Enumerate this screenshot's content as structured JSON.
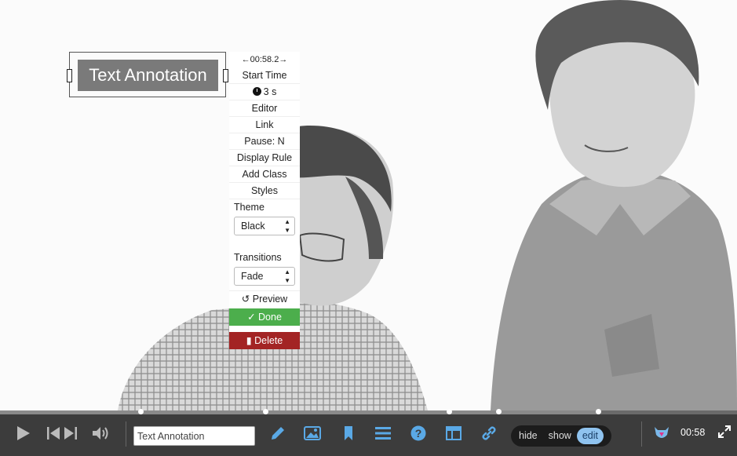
{
  "annotation": {
    "text": "Text Annotation"
  },
  "panel": {
    "time_offset": "←00:58.2→",
    "start_time_label": "Start Time",
    "duration": "3 s",
    "editor_label": "Editor",
    "link_label": "Link",
    "pause_label": "Pause: N",
    "display_rule_label": "Display Rule",
    "add_class_label": "Add Class",
    "styles_label": "Styles",
    "theme_label": "Theme",
    "theme_value": "Black",
    "transitions_label": "Transitions",
    "transitions_value": "Fade",
    "preview_label": "Preview",
    "done_label": "Done",
    "delete_label": "Delete"
  },
  "controlbar": {
    "annotation_input_value": "Text Annotation",
    "modes": [
      "hide",
      "show",
      "edit"
    ],
    "active_mode": "edit",
    "timecode": "00:58",
    "icons": [
      "play-icon",
      "previous-icon",
      "next-icon",
      "volume-icon",
      "pencil-icon",
      "image-icon",
      "bookmark-icon",
      "list-icon",
      "help-icon",
      "layout-icon",
      "link-icon",
      "logo-icon",
      "fullscreen-icon"
    ]
  },
  "colors": {
    "done_green": "#4cae4c",
    "delete_red": "#a32424",
    "active_mode_bg": "#8fc3ef",
    "accent_blue": "#5aa9e6",
    "bar_bg": "#3c3c3c"
  }
}
